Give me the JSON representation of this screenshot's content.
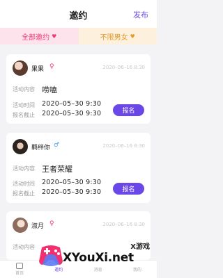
{
  "header": {
    "title": "邀约",
    "publish_label": "发布"
  },
  "filters": [
    {
      "label": "全部邀约",
      "arrow": "♥"
    },
    {
      "label": "不限男女",
      "arrow": "♥"
    }
  ],
  "cards": [
    {
      "name": "果果",
      "gender_symbol": "♀",
      "date": "2020–06–16 8:30",
      "content_label": "活动内容",
      "content": "唠嗑",
      "time_label": "活动时间",
      "time": "2020–05–30  9:30",
      "deadline_label": "报名截止",
      "deadline": "2020–05–30  9:30",
      "signup_label": "报名"
    },
    {
      "name": "羁绊你",
      "gender_symbol": "♂",
      "date": "2020–06–16 8:30",
      "content_label": "活动内容",
      "content": "王者荣耀",
      "time_label": "活动时间",
      "time": "2020–05–30  9:30",
      "deadline_label": "报名截止",
      "deadline": "2020–05–30  9:30",
      "signup_label": "报名"
    },
    {
      "name": "淑月",
      "gender_symbol": "♀",
      "date": "2020–06–16 8:30",
      "content_label": "活动内容"
    }
  ],
  "tabbar": [
    {
      "label": "首页"
    },
    {
      "label": "邀约"
    },
    {
      "label": "消息"
    },
    {
      "label": "我的"
    }
  ],
  "watermark": {
    "small": "X游戏",
    "big": "XYouXi.net"
  },
  "colors": {
    "accent": "#6c47e8",
    "pink": "#f43a78",
    "orange": "#e39a2a",
    "blue": "#4a9cf0"
  }
}
